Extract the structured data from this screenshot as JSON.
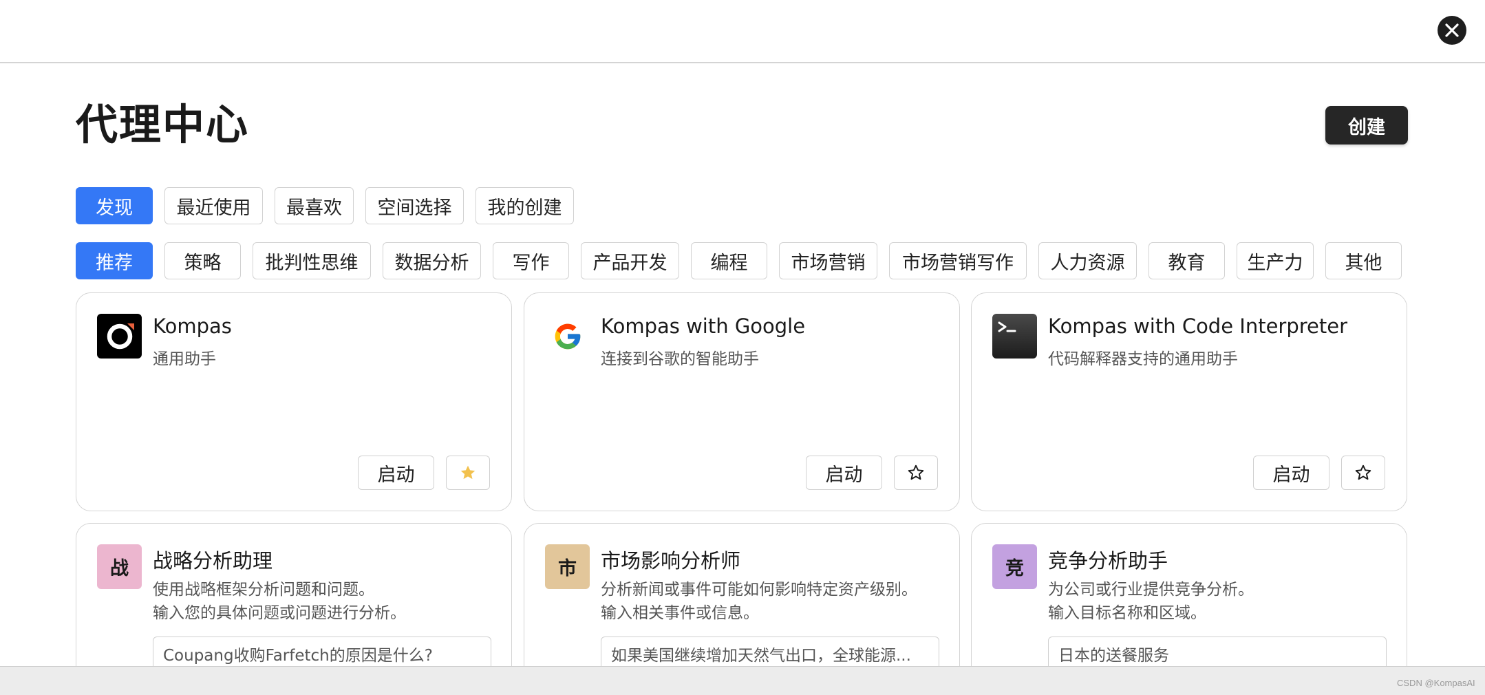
{
  "header": {
    "title": "代理中心",
    "create_label": "创建"
  },
  "main_tabs": [
    {
      "label": "发现",
      "active": true
    },
    {
      "label": "最近使用",
      "active": false
    },
    {
      "label": "最喜欢",
      "active": false
    },
    {
      "label": "空间选择",
      "active": false
    },
    {
      "label": "我的创建",
      "active": false
    }
  ],
  "category_tabs": [
    {
      "label": "推荐",
      "active": true
    },
    {
      "label": "策略",
      "active": false
    },
    {
      "label": "批判性思维",
      "active": false
    },
    {
      "label": "数据分析",
      "active": false
    },
    {
      "label": "写作",
      "active": false
    },
    {
      "label": "产品开发",
      "active": false
    },
    {
      "label": "编程",
      "active": false
    },
    {
      "label": "市场营销",
      "active": false
    },
    {
      "label": "市场营销写作",
      "active": false
    },
    {
      "label": "人力资源",
      "active": false
    },
    {
      "label": "教育",
      "active": false
    },
    {
      "label": "生产力",
      "active": false
    },
    {
      "label": "其他",
      "active": false
    }
  ],
  "agents": [
    {
      "title": "Kompas",
      "description": "通用助手",
      "icon": "kompas-logo-icon",
      "start_label": "启动",
      "favorited": true
    },
    {
      "title": "Kompas with Google",
      "description": "连接到谷歌的智能助手",
      "icon": "google-logo-icon",
      "start_label": "启动",
      "favorited": false
    },
    {
      "title": "Kompas with Code Interpreter",
      "description": "代码解释器支持的通用助手",
      "icon": "terminal-icon",
      "start_label": "启动",
      "favorited": false
    }
  ],
  "prompt_agents": [
    {
      "icon_char": "战",
      "icon_color": "#ecb6cf",
      "title": "战略分析助理",
      "desc_line1": "使用战略框架分析问题和问题。",
      "desc_line2": "输入您的具体问题或问题进行分析。",
      "input_value": "Coupang收购Farfetch的原因是什么?"
    },
    {
      "icon_char": "市",
      "icon_color": "#e2c69a",
      "title": "市场影响分析师",
      "desc_line1": "分析新闻或事件可能如何影响特定资产级别。",
      "desc_line2": "输入相关事件或信息。",
      "input_value": "如果美国继续增加天然气出口，全球能源..."
    },
    {
      "icon_char": "竞",
      "icon_color": "#c3a1e0",
      "title": "竞争分析助手",
      "desc_line1": "为公司或行业提供竞争分析。",
      "desc_line2": "输入目标名称和区域。",
      "input_value": "日本的送餐服务"
    }
  ],
  "colors": {
    "accent": "#3478f6",
    "dark_button": "#262626",
    "star_filled": "#f2c14e"
  },
  "watermark": "CSDN @KompasAI"
}
